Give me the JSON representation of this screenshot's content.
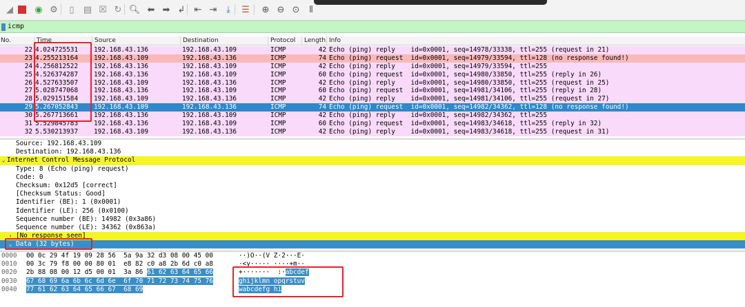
{
  "toolbar": {
    "buttons": [
      {
        "name": "start-capture-icon",
        "glyph": "◢",
        "color": "#8a8a8a"
      },
      {
        "name": "stop-capture-icon",
        "glyph": "■",
        "color": "#d63030"
      },
      {
        "name": "restart-capture-icon",
        "glyph": "◉",
        "color": "#3aa53a"
      },
      {
        "name": "capture-options-icon",
        "glyph": "⚙",
        "color": "#777777"
      },
      {
        "name": "open-file-icon",
        "glyph": "▯",
        "color": "#8a8a8a"
      },
      {
        "name": "save-file-icon",
        "glyph": "▤",
        "color": "#8a8a8a"
      },
      {
        "name": "close-file-icon",
        "glyph": "☒",
        "color": "#8a8a8a"
      },
      {
        "name": "reload-file-icon",
        "glyph": "↻",
        "color": "#8a8a8a"
      },
      {
        "name": "find-packet-icon",
        "glyph": "🔍︎",
        "color": "#555555"
      },
      {
        "name": "go-back-icon",
        "glyph": "⬅",
        "color": "#555555"
      },
      {
        "name": "go-forward-icon",
        "glyph": "➡",
        "color": "#555555"
      },
      {
        "name": "go-to-packet-icon",
        "glyph": "↲",
        "color": "#555555"
      },
      {
        "name": "first-packet-icon",
        "glyph": "⇤",
        "color": "#555555"
      },
      {
        "name": "last-packet-icon",
        "glyph": "⇥",
        "color": "#555555"
      },
      {
        "name": "auto-scroll-icon",
        "glyph": "⤓",
        "color": "#3a6fb0"
      },
      {
        "name": "colorize-icon",
        "glyph": "☰",
        "color": "#c05a30"
      },
      {
        "name": "zoom-in-icon",
        "glyph": "⊕",
        "color": "#555555"
      },
      {
        "name": "zoom-out-icon",
        "glyph": "⊖",
        "color": "#555555"
      },
      {
        "name": "normal-size-icon",
        "glyph": "⊙",
        "color": "#555555"
      },
      {
        "name": "resize-columns-icon",
        "glyph": "⫴",
        "color": "#555555"
      }
    ]
  },
  "filter": {
    "value": "icmp",
    "bookmark_icon": "bookmark-icon",
    "background": "#c4f5c4"
  },
  "packet_list": {
    "columns": [
      "No.",
      "Time",
      "Source",
      "Destination",
      "Protocol",
      "Length",
      "Info"
    ],
    "row_colors": {
      "normal": "#fadafa",
      "no_response": "#f9b9b9",
      "selected": "#2e88c9"
    },
    "rows": [
      {
        "no": "22",
        "time": "4.024725531",
        "src": "192.168.43.136",
        "dst": "192.168.43.109",
        "proto": "ICMP",
        "len": "42",
        "info": "Echo (ping) reply    id=0x0001, seq=14978/33338, ttl=255 (request in 21)",
        "style": "normal"
      },
      {
        "no": "23",
        "time": "4.255213164",
        "src": "192.168.43.109",
        "dst": "192.168.43.136",
        "proto": "ICMP",
        "len": "74",
        "info": "Echo (ping) request  id=0x0001, seq=14979/33594, ttl=128 (no response found!)",
        "style": "no_response"
      },
      {
        "no": "24",
        "time": "4.256812522",
        "src": "192.168.43.136",
        "dst": "192.168.43.109",
        "proto": "ICMP",
        "len": "42",
        "info": "Echo (ping) reply    id=0x0001, seq=14979/33594, ttl=255",
        "style": "normal"
      },
      {
        "no": "25",
        "time": "4.526374287",
        "src": "192.168.43.136",
        "dst": "192.168.43.109",
        "proto": "ICMP",
        "len": "60",
        "info": "Echo (ping) request  id=0x0001, seq=14980/33850, ttl=255 (reply in 26)",
        "style": "normal"
      },
      {
        "no": "26",
        "time": "4.527633507",
        "src": "192.168.43.109",
        "dst": "192.168.43.136",
        "proto": "ICMP",
        "len": "42",
        "info": "Echo (ping) reply    id=0x0001, seq=14980/33850, ttl=255 (request in 25)",
        "style": "normal"
      },
      {
        "no": "27",
        "time": "5.028747068",
        "src": "192.168.43.136",
        "dst": "192.168.43.109",
        "proto": "ICMP",
        "len": "60",
        "info": "Echo (ping) request  id=0x0001, seq=14981/34106, ttl=255 (reply in 28)",
        "style": "normal"
      },
      {
        "no": "28",
        "time": "5.029151584",
        "src": "192.168.43.109",
        "dst": "192.168.43.136",
        "proto": "ICMP",
        "len": "42",
        "info": "Echo (ping) reply    id=0x0001, seq=14981/34106, ttl=255 (request in 27)",
        "style": "normal"
      },
      {
        "no": "29",
        "time": "5.267052843",
        "src": "192.168.43.109",
        "dst": "192.168.43.136",
        "proto": "ICMP",
        "len": "74",
        "info": "Echo (ping) request  id=0x0001, seq=14982/34362, ttl=128 (no response found!)",
        "style": "selected"
      },
      {
        "no": "30",
        "time": "5.267713661",
        "src": "192.168.43.136",
        "dst": "192.168.43.109",
        "proto": "ICMP",
        "len": "42",
        "info": "Echo (ping) reply    id=0x0001, seq=14982/34362, ttl=255",
        "style": "normal"
      },
      {
        "no": "31",
        "time": "5.529845783",
        "src": "192.168.43.136",
        "dst": "192.168.43.109",
        "proto": "ICMP",
        "len": "60",
        "info": "Echo (ping) request  id=0x0001, seq=14983/34618, ttl=255 (reply in 32)",
        "style": "normal"
      },
      {
        "no": "32",
        "time": "5.530213937",
        "src": "192.168.43.109",
        "dst": "192.168.43.136",
        "proto": "ICMP",
        "len": "42",
        "info": "Echo (ping) reply    id=0x0001, seq=14983/34618, ttl=255 (request in 31)",
        "style": "normal"
      }
    ]
  },
  "details": {
    "rows": [
      {
        "text": "Source: 192.168.43.109",
        "indent": 1,
        "twisty": "",
        "style": ""
      },
      {
        "text": "Destination: 192.168.43.136",
        "indent": 1,
        "twisty": "",
        "style": ""
      },
      {
        "text": "Internet Control Message Protocol",
        "indent": 0,
        "twisty": "⌄",
        "style": "hl-yellow"
      },
      {
        "text": "Type: 8 (Echo (ping) request)",
        "indent": 1,
        "twisty": "",
        "style": ""
      },
      {
        "text": "Code: 0",
        "indent": 1,
        "twisty": "",
        "style": ""
      },
      {
        "text": "Checksum: 0x12d5 [correct]",
        "indent": 1,
        "twisty": "",
        "style": ""
      },
      {
        "text": "[Checksum Status: Good]",
        "indent": 1,
        "twisty": "",
        "style": ""
      },
      {
        "text": "Identifier (BE): 1 (0x0001)",
        "indent": 1,
        "twisty": "",
        "style": ""
      },
      {
        "text": "Identifier (LE): 256 (0x0100)",
        "indent": 1,
        "twisty": "",
        "style": ""
      },
      {
        "text": "Sequence number (BE): 14982 (0x3a86)",
        "indent": 1,
        "twisty": "",
        "style": ""
      },
      {
        "text": "Sequence number (LE): 34362 (0x863a)",
        "indent": 1,
        "twisty": "",
        "style": ""
      },
      {
        "text": "[No response seen]",
        "indent": 1,
        "twisty": "›",
        "style": "hl-yellow"
      },
      {
        "text": "Data (32 bytes)",
        "indent": 1,
        "twisty": "⌄",
        "style": "hl-blue"
      }
    ]
  },
  "bytes": {
    "rows": [
      {
        "offset": "0000",
        "hex": [
          [
            "00 0c 29 4f 19 09 28 56  5a 9a 32 d3 08 00 45 00",
            false
          ]
        ],
        "ascii": [
          [
            "··)O··(V Z·2···E·",
            false
          ]
        ]
      },
      {
        "offset": "0010",
        "hex": [
          [
            "00 3c 79 f8 00 00 80 01  e8 82 c0 a8 2b 6d c0 a8",
            false
          ]
        ],
        "ascii": [
          [
            "·<y····· ····+m··",
            false
          ]
        ]
      },
      {
        "offset": "0020",
        "hex": [
          [
            "2b 88 08 00 12 d5 00 01  3a 86 ",
            false
          ],
          [
            "61 62 63 64 65 66",
            true
          ]
        ],
        "ascii": [
          [
            "+·······  :·",
            false
          ],
          [
            "abcdef",
            true
          ]
        ]
      },
      {
        "offset": "0030",
        "hex": [
          [
            "67 68 69 6a 6b 6c 6d 6e  6f 70 71 72 73 74 75 76",
            true
          ]
        ],
        "ascii": [
          [
            "ghijklmn opqrstuv",
            true
          ]
        ]
      },
      {
        "offset": "0040",
        "hex": [
          [
            "77 61 62 63 64 65 66 67  68 69",
            true
          ]
        ],
        "ascii": [
          [
            "wabcdefg hi",
            true
          ]
        ]
      }
    ]
  }
}
